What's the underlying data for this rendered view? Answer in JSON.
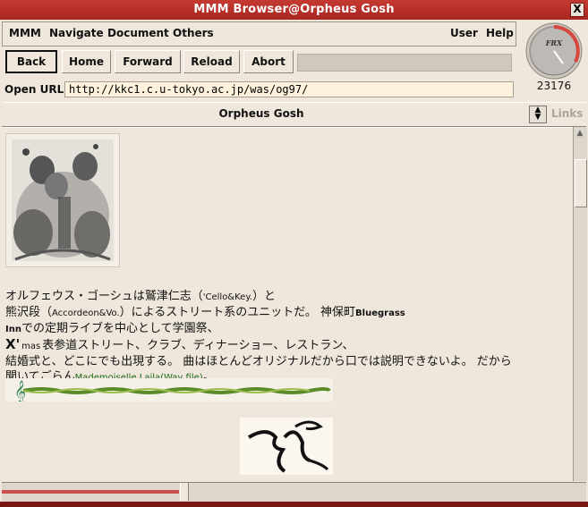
{
  "window": {
    "title": "MMM Browser@Orpheus Gosh",
    "close_label": "X"
  },
  "menu": {
    "items": [
      "MMM",
      "Navigate",
      "Document",
      "Others"
    ],
    "right_items": [
      "User",
      "Help"
    ]
  },
  "toolbar": {
    "back": "Back",
    "home": "Home",
    "forward": "Forward",
    "reload": "Reload",
    "abort": "Abort"
  },
  "url": {
    "label": "Open URL:",
    "value": "http://kkc1.c.u-tokyo.ac.jp/was/og97/"
  },
  "logo": {
    "text": "FRX",
    "counter": "23176"
  },
  "page": {
    "title": "Orpheus Gosh",
    "links_label": "Links"
  },
  "content": {
    "p1a": "オルフェウス・ゴーシュは鷲津仁志（",
    "p1b": "'Cello&Key.",
    "p1c": "）と",
    "p2a": "熊沢段（",
    "p2b": "Accordeon&Vo.",
    "p2c": "）によるストリート系のユニットだ。 神保町",
    "p2d": "Bluegrass",
    "p3a": "Inn",
    "p3b": "での定期ライブを中心として学園祭、",
    "p4a": "X'",
    "p4b": "mas",
    "p4c": "表参道ストリート、クラブ、ディナーショー、レストラン、",
    "p5": "結婚式と、どこにでも出現する。 曲はほとんどオリジナルだから口では説明できないよ。 だから",
    "p6a": "聞いてごらん",
    "p6b": "Mademoiselle Laila(Wav file)",
    "p6c": "。"
  },
  "colors": {
    "titlebar": "#b32c25",
    "background": "#efe7db",
    "link": "#1a6b1a"
  }
}
